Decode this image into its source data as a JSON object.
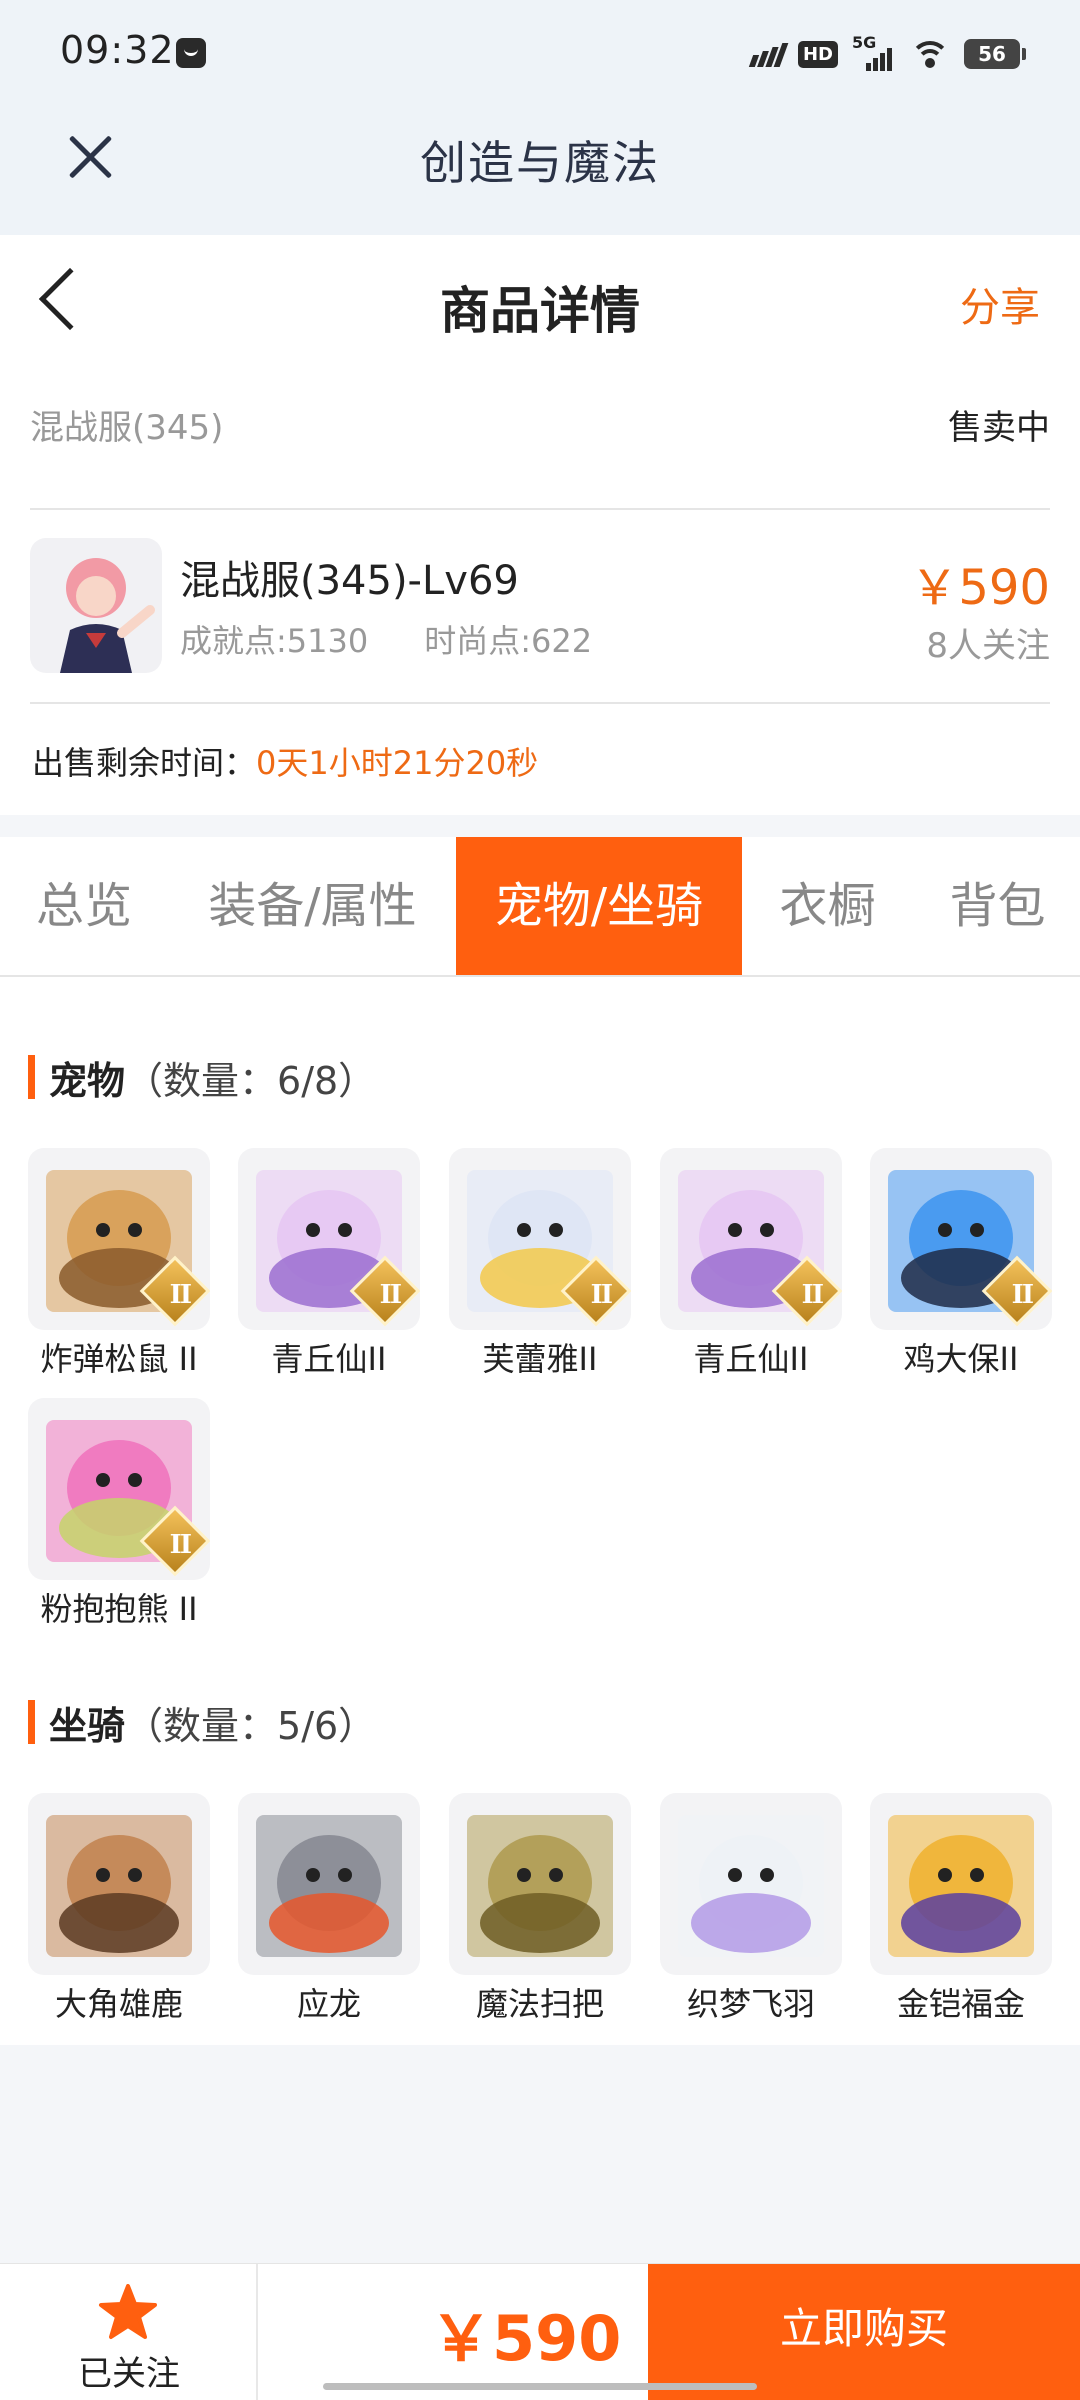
{
  "status_bar": {
    "time": "09:32",
    "network_badge": "HD",
    "signal_type": "5G",
    "battery": "56"
  },
  "app_header": {
    "title": "创造与魔法"
  },
  "nav": {
    "title": "商品详情",
    "share_label": "分享"
  },
  "listing": {
    "server": "混战服(345)",
    "status": "售卖中",
    "name": "混战服(345)-Lv69",
    "achievement": "成就点:5130",
    "fashion": "时尚点:622",
    "price": "￥590",
    "followers": "8人关注",
    "time_label": "出售剩余时间：",
    "time_remaining": "0天1小时21分20秒"
  },
  "tabs": [
    {
      "label": "总览",
      "active": false
    },
    {
      "label": "装备/属性",
      "active": false
    },
    {
      "label": "宠物/坐骑",
      "active": true
    },
    {
      "label": "衣橱",
      "active": false
    },
    {
      "label": "背包",
      "active": false
    }
  ],
  "pets_section": {
    "title": "宠物",
    "count": "（数量：6/8）",
    "items": [
      {
        "label": "炸弹松鼠 II",
        "badge": "II",
        "colors": [
          "#d9a25c",
          "#8a5a2b"
        ]
      },
      {
        "label": "青丘仙II",
        "badge": "II",
        "colors": [
          "#e7c9f3",
          "#9b6fd0"
        ]
      },
      {
        "label": "芙蕾雅II",
        "badge": "II",
        "colors": [
          "#dfe6f5",
          "#f3c94a"
        ]
      },
      {
        "label": "青丘仙II",
        "badge": "II",
        "colors": [
          "#e7c9f3",
          "#9b6fd0"
        ]
      },
      {
        "label": "鸡大保II",
        "badge": "II",
        "colors": [
          "#4a9bf0",
          "#1f2b47"
        ]
      },
      {
        "label": "粉抱抱熊 II",
        "badge": "II",
        "colors": [
          "#f07bc0",
          "#c5d46a"
        ]
      }
    ]
  },
  "mounts_section": {
    "title": "坐骑",
    "count": "（数量：5/6）",
    "items": [
      {
        "label": "大角雄鹿",
        "colors": [
          "#c58a5a",
          "#5b3a22"
        ]
      },
      {
        "label": "应龙",
        "colors": [
          "#8d8f98",
          "#e6572c"
        ]
      },
      {
        "label": "魔法扫把",
        "colors": [
          "#b3a05a",
          "#6e5d24"
        ]
      },
      {
        "label": "织梦飞羽",
        "colors": [
          "#eef2f6",
          "#b39ae6"
        ]
      },
      {
        "label": "金铠福金",
        "colors": [
          "#f0b63c",
          "#5a3fa0"
        ]
      }
    ]
  },
  "bottom_bar": {
    "followed_label": "已关注",
    "price": "￥590",
    "buy_label": "立即购买"
  },
  "colors": {
    "accent": "#ff5f0f",
    "price_orange": "#ee6a14",
    "gold": "#f3c15a"
  }
}
